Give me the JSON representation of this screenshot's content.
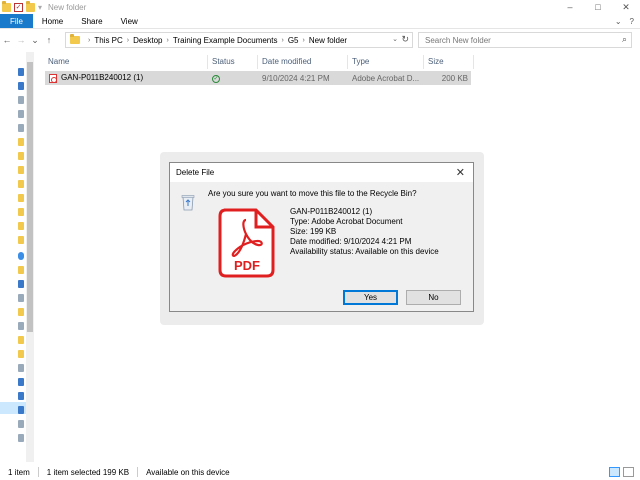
{
  "window": {
    "title": "New folder",
    "controls": [
      "–",
      "□",
      "✕"
    ]
  },
  "ribbon": {
    "tabs": [
      "File",
      "Home",
      "Share",
      "View"
    ]
  },
  "address": {
    "crumbs": [
      "This PC",
      "Desktop",
      "Training Example Documents",
      "G5",
      "New folder"
    ]
  },
  "search": {
    "placeholder": "Search New folder"
  },
  "columns": [
    "Name",
    "Status",
    "Date modified",
    "Type",
    "Size"
  ],
  "files": [
    {
      "name": "GAN-P011B240012 (1)",
      "status": "available",
      "date_modified": "9/10/2024 4:21 PM",
      "type": "Adobe Acrobat D...",
      "size": "200 KB"
    }
  ],
  "dialog": {
    "title": "Delete File",
    "question": "Are you sure you want to move this file to the Recycle Bin?",
    "file_name": "GAN-P011B240012 (1)",
    "type_line": "Type: Adobe Acrobat Document",
    "size_line": "Size: 199 KB",
    "date_line": "Date modified: 9/10/2024 4:21 PM",
    "availability_line": "Availability status: Available on this device",
    "pdf_label": "PDF",
    "yes_label": "Yes",
    "no_label": "No"
  },
  "statusbar": {
    "item_count": "1 item",
    "selected": "1 item selected  199 KB",
    "availability": "Available on this device"
  },
  "colors": {
    "accent": "#1979ca",
    "pdf_red": "#e02020",
    "selection": "#d9d9d9"
  }
}
